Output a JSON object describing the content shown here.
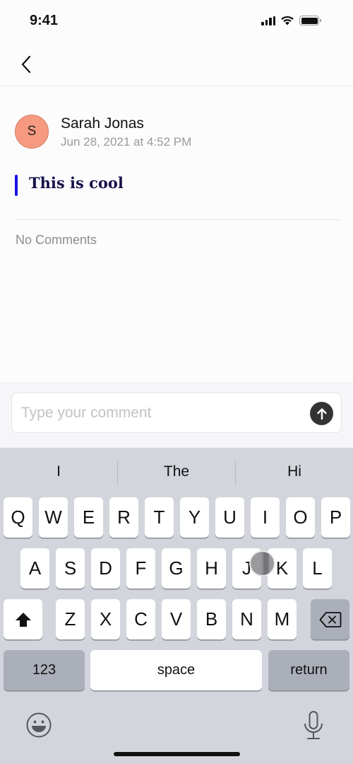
{
  "status_bar": {
    "time": "9:41",
    "icons": [
      "signal-icon",
      "wifi-icon",
      "battery-icon"
    ]
  },
  "nav": {
    "back_icon": "chevron-left-icon"
  },
  "post": {
    "author_initial": "S",
    "author_name": "Sarah Jonas",
    "date": "Jun 28, 2021 at 4:52 PM",
    "title": "This is cool",
    "comments_status": "No Comments",
    "colors": {
      "avatar": "#f59a80",
      "accent_bar": "#1a12e6",
      "title": "#16124a"
    }
  },
  "composer": {
    "value": "",
    "placeholder": "Type your comment",
    "send_icon": "arrow-up-icon"
  },
  "keyboard": {
    "suggestions": [
      "I",
      "The",
      "Hi"
    ],
    "row1": [
      "Q",
      "W",
      "E",
      "R",
      "T",
      "Y",
      "U",
      "I",
      "O",
      "P"
    ],
    "row2": [
      "A",
      "S",
      "D",
      "F",
      "G",
      "H",
      "J",
      "K",
      "L"
    ],
    "row3": [
      "Z",
      "X",
      "C",
      "V",
      "B",
      "N",
      "M"
    ],
    "shift_icon": "shift-icon",
    "delete_icon": "backspace-icon",
    "numbers_label": "123",
    "space_label": "space",
    "return_label": "return",
    "emoji_icon": "emoji-icon",
    "mic_icon": "microphone-icon"
  }
}
